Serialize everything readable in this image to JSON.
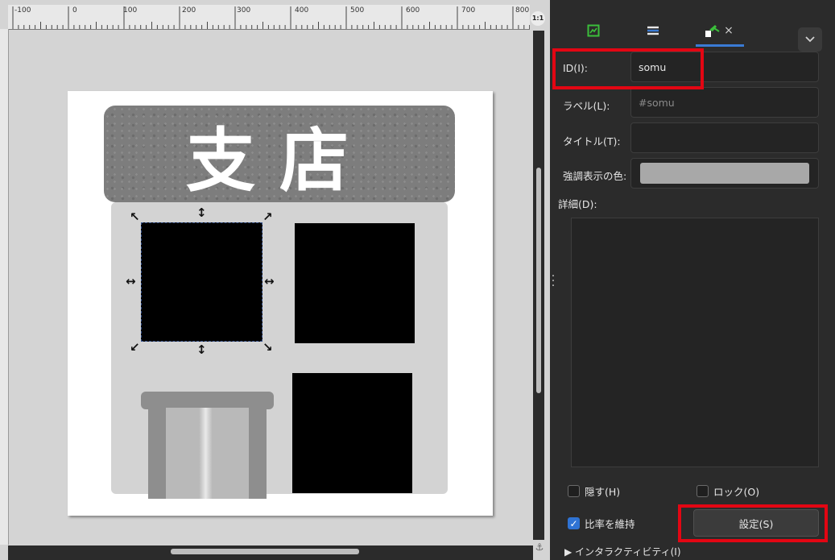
{
  "ruler": {
    "labels": [
      "-100",
      "0",
      "100",
      "200",
      "300",
      "400",
      "500",
      "600",
      "700",
      "800"
    ]
  },
  "canvas": {
    "zoom_badge": "1:1",
    "sign_text": "支店"
  },
  "panel": {
    "tabs": [
      {
        "icon": "image-properties-icon",
        "active": false
      },
      {
        "icon": "layers-icon",
        "active": false
      },
      {
        "icon": "object-properties-icon",
        "active": true,
        "close": "×"
      }
    ],
    "id_label": "ID(I):",
    "id_value": "somu",
    "label_label": "ラベル(L):",
    "label_placeholder": "#somu",
    "title_label": "タイトル(T):",
    "title_value": "",
    "highlight_label": "強調表示の色:",
    "highlight_color": "#a8a8a8",
    "description_label": "詳細(D):",
    "hide_label": "隠す(H)",
    "hide_checked": false,
    "lock_label": "ロック(O)",
    "lock_checked": false,
    "keep_ratio_label": "比率を維持",
    "keep_ratio_checked": true,
    "set_button": "設定(S)",
    "interactivity_label": "▶ インタラクティビティ(I)"
  },
  "colors": {
    "accent": "#2f73d4",
    "callout": "#e30613",
    "panel_bg": "#2b2b2b"
  }
}
